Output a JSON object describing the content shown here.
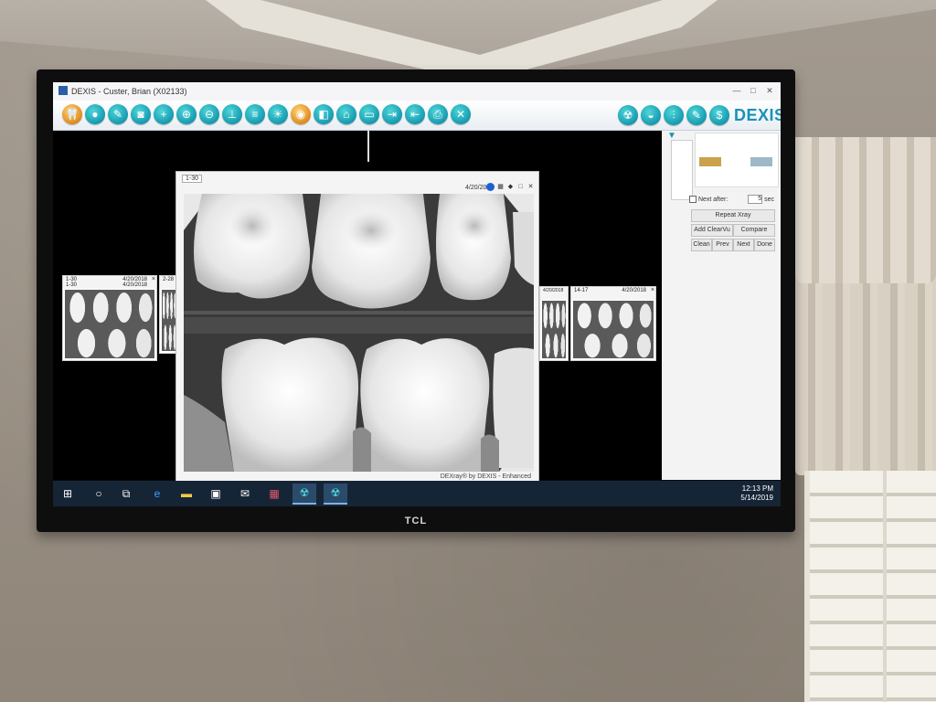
{
  "window": {
    "title": "DEXIS - Custer, Brian (X02133)",
    "controls": [
      "—",
      "□",
      "✕"
    ]
  },
  "toolbar": {
    "left_icons": [
      "tooth-icon",
      "user-icon",
      "pencil-icon",
      "camera-icon",
      "crosshair-icon",
      "zoom-in-icon",
      "zoom-out-icon",
      "measure-icon",
      "notes-icon",
      "brightness-icon",
      "eye-icon",
      "tooth-chart-icon",
      "home-icon",
      "folder-open-icon",
      "export-icon",
      "import-icon",
      "print-icon",
      "close-icon"
    ],
    "right_icons": [
      "radiation-icon",
      "sensor-icon",
      "tooth-implant-icon",
      "pen-icon",
      "dollar-icon"
    ],
    "brand": "DEXIS"
  },
  "thumbnails": {
    "left": {
      "label_top": "1-30",
      "date_top": "4/20/2018",
      "label_bottom": "1-30",
      "date_bottom": "4/20/2018"
    },
    "left_partial": {
      "label": "2-28"
    },
    "right_partial": {
      "date": "4/20/2018"
    },
    "right": {
      "label": "14-17",
      "date": "4/20/2018"
    }
  },
  "viewer": {
    "tab_label": "1-30",
    "date": "4/20/2018",
    "footer": "DEXray® by DEXIS - Enhanced"
  },
  "side_panel": {
    "next_after_label": "Next after:",
    "next_after_value": "5",
    "next_after_unit": "sec",
    "repeat_xray": "Repeat Xray",
    "add_clearvu": "Add ClearVu",
    "compare": "Compare",
    "clean": "Clean",
    "prev": "Prev",
    "next": "Next",
    "done": "Done"
  },
  "taskbar": {
    "time": "12:13 PM",
    "date": "5/14/2019"
  },
  "tv": {
    "brand": "TCL"
  },
  "colors": {
    "accent": "#1792b8",
    "taskbar": "#162536"
  }
}
